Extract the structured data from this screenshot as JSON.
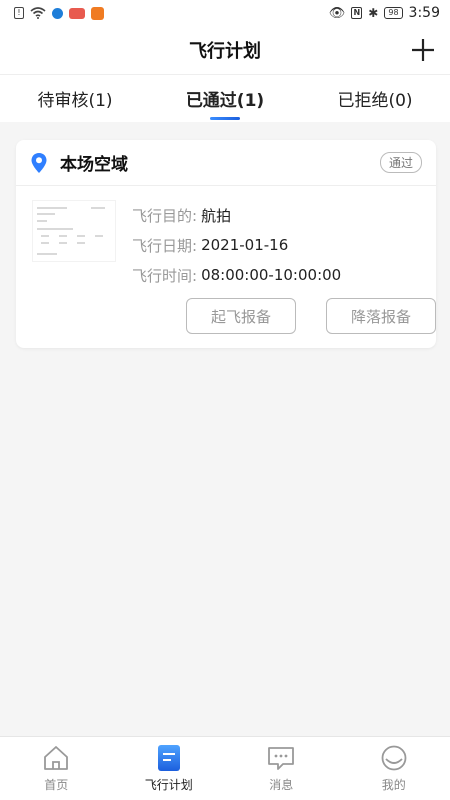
{
  "status_bar": {
    "sim": "!",
    "nfc": "N",
    "battery": "98",
    "time": "3:59"
  },
  "header": {
    "title": "飞行计划"
  },
  "tabs": [
    {
      "label": "待审核(1)",
      "active": false
    },
    {
      "label": "已通过(1)",
      "active": true
    },
    {
      "label": "已拒绝(0)",
      "active": false
    }
  ],
  "card": {
    "title": "本场空域",
    "status": "通过",
    "purpose_label": "飞行目的:",
    "purpose_value": "航拍",
    "date_label": "飞行日期:",
    "date_value": "2021-01-16",
    "time_label": "飞行时间:",
    "time_value": "08:00:00-10:00:00",
    "takeoff_button": "起飞报备",
    "landing_button": "降落报备"
  },
  "bottom_nav": [
    {
      "label": "首页",
      "icon": "home-icon",
      "active": false
    },
    {
      "label": "飞行计划",
      "icon": "flight-plan-icon",
      "active": true
    },
    {
      "label": "消息",
      "icon": "message-icon",
      "active": false
    },
    {
      "label": "我的",
      "icon": "profile-icon",
      "active": false
    }
  ],
  "colors": {
    "accent": "#1c5fdd",
    "pin": "#2f7fff",
    "background": "#f5f5f5"
  }
}
